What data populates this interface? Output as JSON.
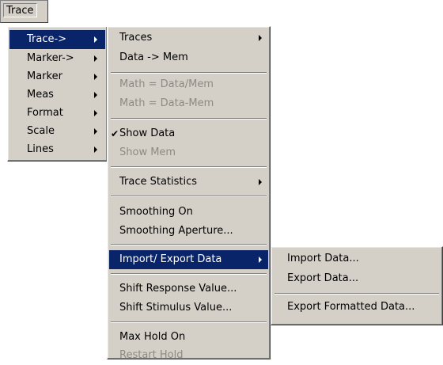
{
  "menubar": {
    "trace_label": "Trace"
  },
  "trace_menu": {
    "items": [
      {
        "label": "Trace->"
      },
      {
        "label": "Marker->"
      },
      {
        "label": "Marker"
      },
      {
        "label": "Meas"
      },
      {
        "label": "Format"
      },
      {
        "label": "Scale"
      },
      {
        "label": "Lines"
      }
    ]
  },
  "trace_submenu": {
    "items": [
      {
        "label": "Traces"
      },
      {
        "label": "Data -> Mem"
      },
      {
        "label": "Math = Data/Mem"
      },
      {
        "label": "Math = Data-Mem"
      },
      {
        "label": "Show Data"
      },
      {
        "label": "Show Mem"
      },
      {
        "label": "Trace Statistics"
      },
      {
        "label": "Smoothing On"
      },
      {
        "label": "Smoothing Aperture..."
      },
      {
        "label": "Import/ Export Data"
      },
      {
        "label": "Shift Response Value..."
      },
      {
        "label": "Shift Stimulus Value..."
      },
      {
        "label": "Max Hold On"
      },
      {
        "label": "Restart Hold"
      }
    ]
  },
  "import_export_submenu": {
    "items": [
      {
        "label": "Import Data..."
      },
      {
        "label": "Export Data..."
      },
      {
        "label": "Export Formatted Data..."
      }
    ]
  },
  "icons": {
    "checkmark": "✔"
  },
  "colors": {
    "menu_bg": "#d4d0c8",
    "highlight_bg": "#0a246a",
    "disabled_text": "#8c8a84"
  }
}
